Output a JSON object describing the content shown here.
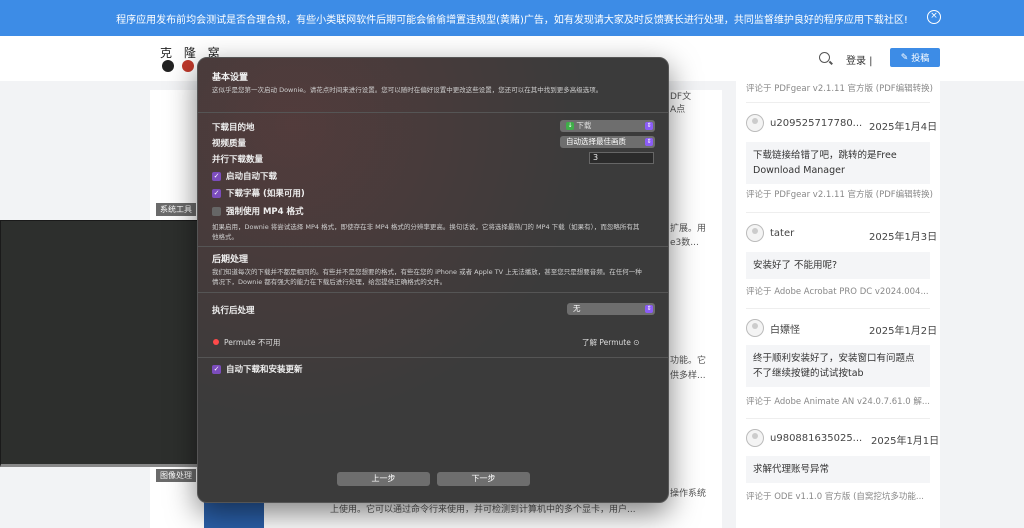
{
  "notice": {
    "text": "程序应用发布前均会测试是否合理合规，有些小类联网软件后期可能会偷偷增置违规型(黄赌)广告，如有发现请大家及时反馈赛长进行处理，共同监督维护良好的程序应用下载社区!",
    "close_icon": "×"
  },
  "header": {
    "logo_text": "克 隆 窝",
    "login_label": "登录",
    "post_label": "投稿"
  },
  "main": {
    "tag1": "系统工具",
    "tag2": "图像处理",
    "frag1a": "DF文",
    "frag1b": "A点",
    "frag2a": "扩展。用",
    "frag2b": "e3数...",
    "frag3a": "功能。它",
    "frag3b": "供多样...",
    "frag4a": "操作系统",
    "frag4b": "上使用。它可以通过命令行来使用，并可检测到计算机中的多个显卡，用户..."
  },
  "sidebar": {
    "top_src": "评论于 PDFgear v2.1.11 官方版 (PDF编辑转换)",
    "comments": [
      {
        "user": "u209525717780...",
        "date": "2025年1月4日",
        "text": "下载链接给错了吧，跳转的是Free Download Manager",
        "src": "评论于 PDFgear v2.1.11 官方版 (PDF编辑转换)"
      },
      {
        "user": "tater",
        "date": "2025年1月3日",
        "text": "安装好了 不能用呢?",
        "src": "评论于 Adobe Acrobat PRO DC v2024.004..."
      },
      {
        "user": "白嫖怪",
        "date": "2025年1月2日",
        "text": "终于顺利安装好了，安装窗口有问题点不了继续按键的试试按tab",
        "src": "评论于 Adobe Animate AN v24.0.7.61.0 解..."
      },
      {
        "user": "u980881635025...",
        "date": "2025年1月1日",
        "text": "求解代理账号异常",
        "src": "评论于 ODE v1.1.0 官方版 (自窝挖坑多功能..."
      }
    ]
  },
  "dialog": {
    "basic_title": "基本设置",
    "basic_desc": "这似乎是您第一次启动 Downie。请花点时间来进行设置。您可以随时在偏好设置中更改这些设置，您还可以在其中找到更多高级选项。",
    "download_dest_label": "下载目的地",
    "download_dest_value": "下载",
    "video_quality_label": "视频质量",
    "video_quality_value": "自动选择最佳画质",
    "parallel_label": "并行下载数量",
    "parallel_value": "3",
    "auto_download_label": "启动自动下载",
    "subtitles_label": "下载字幕 (如果可用)",
    "mp4_label": "强制使用 MP4 格式",
    "mp4_desc": "如果启用，Downie 将尝试选择 MP4 格式，即使存在非 MP4 格式的分辨率更高。换句话说，它将选择最热门的 MP4 下载（如果有），而忽略所有其他格式。",
    "post_title": "后期处理",
    "post_desc": "我们知道每次的下载并不都是相同的。有些并不是您想要的格式，有些在您的 iPhone 或者 Apple TV 上无法播放，甚至您只是想要音频。在任何一种情况下，Downie 都有强大的能力在下载后进行处理，给您提供正确格式的文件。",
    "after_label": "执行后处理",
    "after_value": "无",
    "permute_status": "Permute 不可用",
    "permute_link": "了解 Permute ⊙",
    "auto_update_label": "自动下载和安装更新",
    "prev_label": "上一步",
    "next_label": "下一步"
  }
}
